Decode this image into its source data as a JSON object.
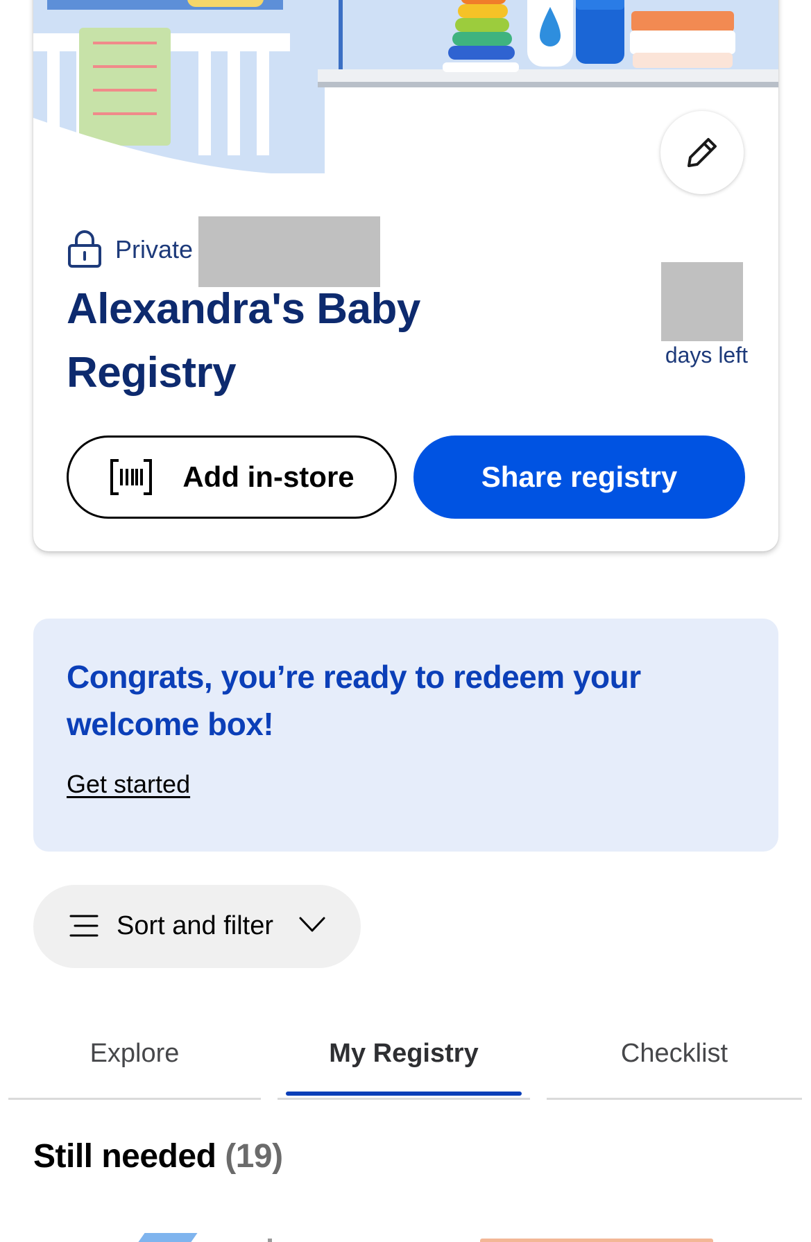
{
  "registry": {
    "privacy_label": "Private",
    "title": "Alexandra's Baby Registry",
    "days_left_label": "days left",
    "add_in_store_label": "Add in-store",
    "share_label": "Share registry"
  },
  "promo": {
    "title": "Congrats, you’re ready to redeem your welcome box!",
    "link_label": "Get started"
  },
  "sort_filter": {
    "label": "Sort and filter"
  },
  "tabs": [
    {
      "label": "Explore",
      "active": false
    },
    {
      "label": "My Registry",
      "active": true
    },
    {
      "label": "Checklist",
      "active": false
    }
  ],
  "section": {
    "title": "Still needed",
    "count": "(19)"
  },
  "colors": {
    "primary_blue": "#0053e2",
    "heading_navy": "#0d2a6e",
    "promo_bg": "#e6edfa",
    "tab_indicator": "#0b3fb8"
  },
  "icons": [
    "pencil-icon",
    "lock-icon",
    "barcode-icon",
    "menu-lines-icon",
    "chevron-down-icon"
  ]
}
